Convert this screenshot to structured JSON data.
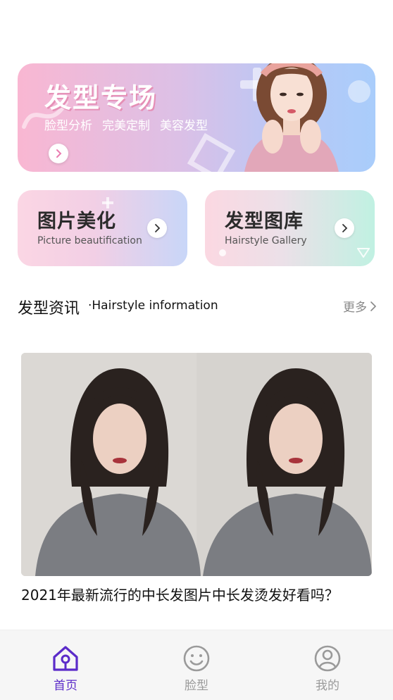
{
  "hero": {
    "title": "发型专场",
    "tags": [
      "脸型分析",
      "完美定制",
      "美容发型"
    ]
  },
  "features": [
    {
      "title": "图片美化",
      "subtitle": "Picture beautification"
    },
    {
      "title": "发型图库",
      "subtitle": "Hairstyle Gallery"
    }
  ],
  "section": {
    "title": "发型资讯",
    "subtitle": "·Hairstyle information",
    "more": "更多"
  },
  "article": {
    "title": "2021年最新流行的中长发图片中长发烫发好看吗？"
  },
  "tabbar": {
    "items": [
      {
        "label": "首页",
        "icon": "home-icon",
        "active": true
      },
      {
        "label": "脸型",
        "icon": "smile-face-icon",
        "active": false
      },
      {
        "label": "我的",
        "icon": "user-profile-icon",
        "active": false
      }
    ]
  },
  "colors": {
    "accent": "#5b2bc9",
    "inactive": "#9a9a9a"
  }
}
